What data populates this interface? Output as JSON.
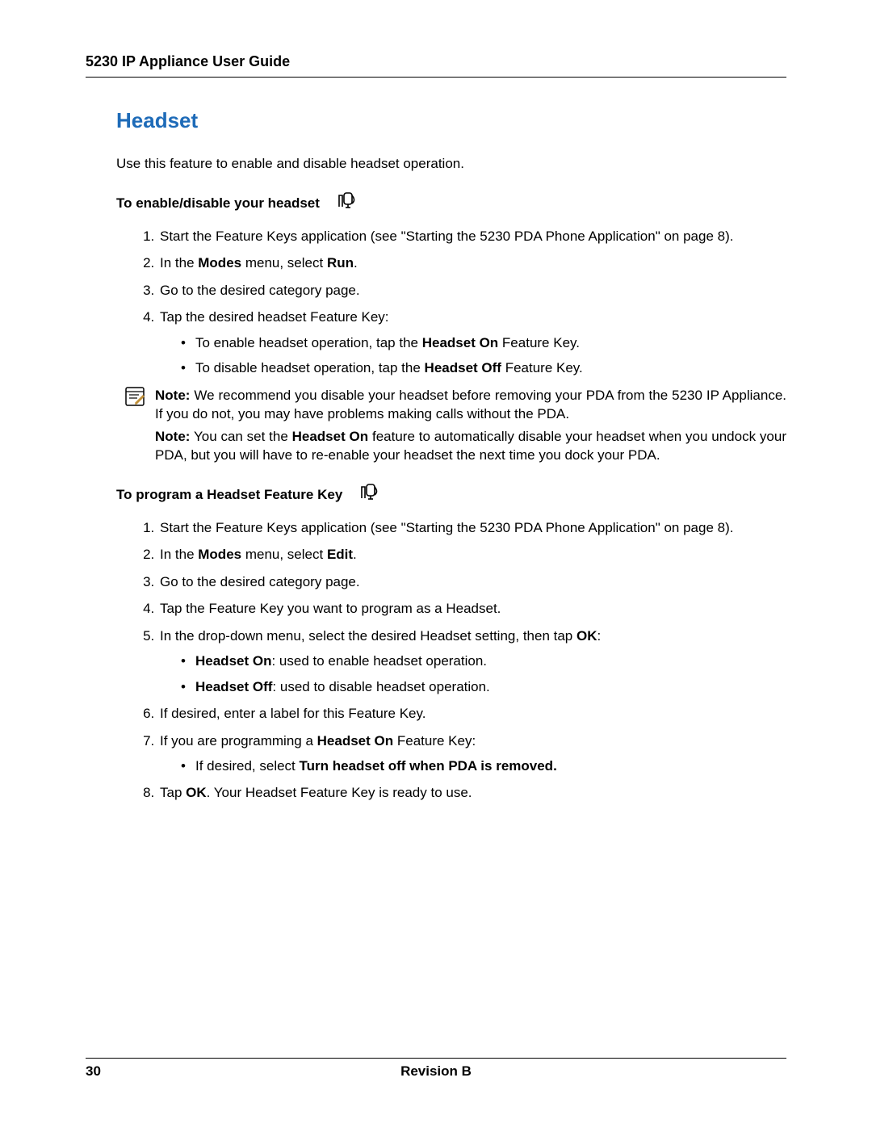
{
  "header": {
    "title": "5230 IP Appliance User Guide"
  },
  "section": {
    "heading": "Headset",
    "intro": "Use this feature to enable and disable headset operation."
  },
  "sub1": {
    "heading": "To enable/disable your headset",
    "steps": {
      "s1a": "Start the Feature Keys application (see \"Starting the 5230 PDA Phone Application\" on page 8).",
      "s2a": "In the ",
      "s2b": "Modes",
      "s2c": " menu, select ",
      "s2d": "Run",
      "s2e": ".",
      "s3": "Go to the desired category page.",
      "s4": "Tap the desired headset Feature Key:",
      "s4_b1a": "To enable headset operation, tap the ",
      "s4_b1b": "Headset On",
      "s4_b1c": " Feature Key.",
      "s4_b2a": "To disable headset operation, tap the ",
      "s4_b2b": "Headset Off",
      "s4_b2c": " Feature Key."
    }
  },
  "note": {
    "p1a": "Note:",
    "p1b": " We recommend you disable your headset before removing your PDA from the 5230 IP Appliance. If you do not, you may have problems making calls without the PDA.",
    "p2a": "Note:",
    "p2b": " You can set the ",
    "p2c": "Headset On",
    "p2d": " feature to automatically disable your headset when you undock your PDA, but you will have to re-enable your headset the next time you dock your PDA."
  },
  "sub2": {
    "heading": "To program a Headset Feature Key",
    "steps": {
      "s1a": "Start the Feature Keys application (see \"Starting the 5230 PDA Phone Application\" on page 8).",
      "s2a": "In the ",
      "s2b": "Modes",
      "s2c": " menu, select ",
      "s2d": "Edit",
      "s2e": ".",
      "s3": "Go to the desired category page.",
      "s4": "Tap the Feature Key you want to program as a Headset.",
      "s5a": "In the drop-down menu, select the desired Headset setting, then tap ",
      "s5b": "OK",
      "s5c": ":",
      "s5_b1a": "Headset On",
      "s5_b1b": ": used to enable headset operation.",
      "s5_b2a": "Headset Off",
      "s5_b2b": ": used to disable headset operation.",
      "s6": "If desired, enter a label for this Feature Key.",
      "s7a": "If you are programming a ",
      "s7b": "Headset On",
      "s7c": " Feature Key:",
      "s7_b1a": "If desired, select ",
      "s7_b1b": "Turn headset off when PDA is removed.",
      "s8a": "Tap ",
      "s8b": "OK",
      "s8c": ". Your Headset Feature Key is ready to use."
    }
  },
  "footer": {
    "page": "30",
    "revision": "Revision B"
  }
}
